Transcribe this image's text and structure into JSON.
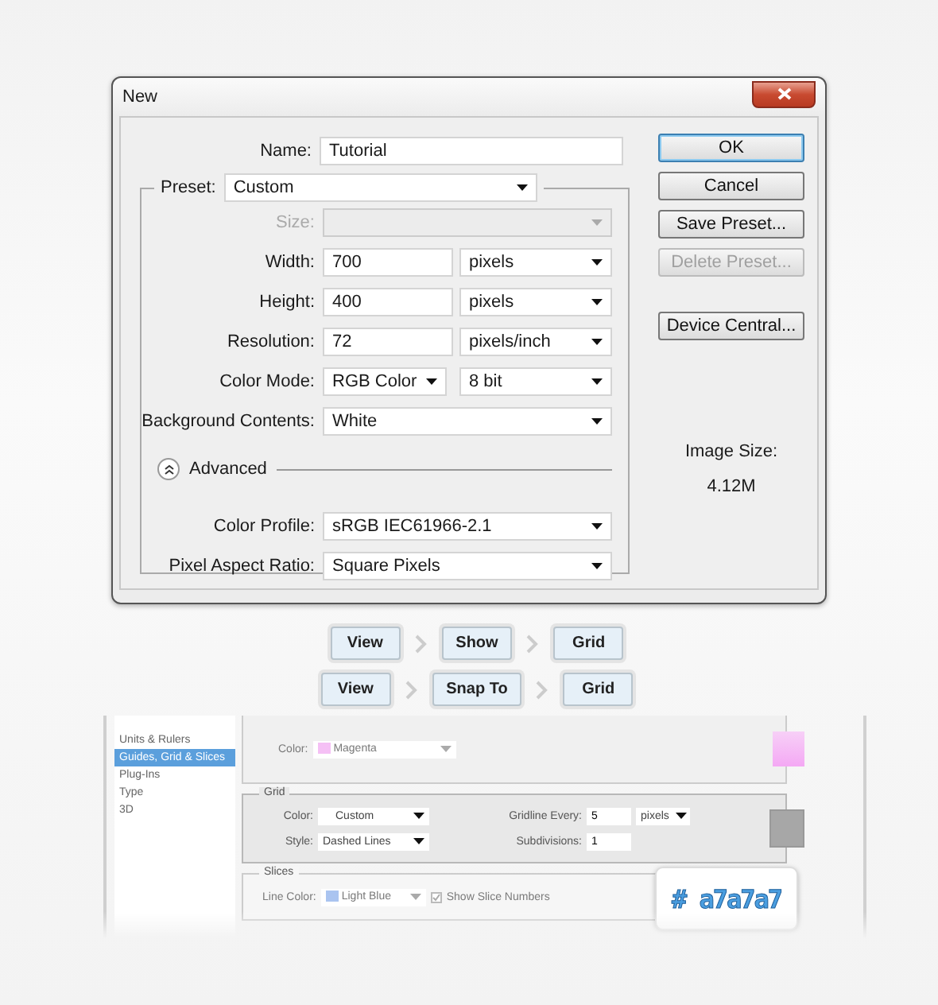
{
  "dialog": {
    "title": "New",
    "name_field": {
      "label": "Name:",
      "value": "Tutorial"
    },
    "preset": {
      "label": "Preset:",
      "value": "Custom"
    },
    "rows": [
      {
        "kind": "select",
        "label": "Size:",
        "disabled": true
      },
      {
        "kind": "pair",
        "label": "Width:",
        "value": "700",
        "unit": "pixels"
      },
      {
        "kind": "pair",
        "label": "Height:",
        "value": "400",
        "unit": "pixels"
      },
      {
        "kind": "pair",
        "label": "Resolution:",
        "value": "72",
        "unit": "pixels/inch"
      },
      {
        "kind": "double",
        "label": "Color Mode:",
        "value": "RGB Color",
        "unit": "8 bit"
      },
      {
        "kind": "select",
        "label": "Background Contents:",
        "value": "White",
        "disabled": false
      }
    ],
    "advanced": {
      "label": "Advanced",
      "expanded": true,
      "rows": [
        {
          "label": "Color Profile:",
          "value": "sRGB IEC61966-2.1"
        },
        {
          "label": "Pixel Aspect Ratio:",
          "value": "Square Pixels"
        }
      ]
    },
    "buttons": [
      {
        "label": "OK",
        "focused": true,
        "disabled": false
      },
      {
        "label": "Cancel",
        "focused": false,
        "disabled": false
      },
      {
        "label": "Save Preset...",
        "focused": false,
        "disabled": false
      },
      {
        "label": "Delete Preset...",
        "focused": false,
        "disabled": true
      },
      {
        "label": "Device Central...",
        "focused": false,
        "disabled": false
      }
    ],
    "image_size": {
      "label": "Image Size:",
      "value": "4.12M"
    }
  },
  "menu_paths": [
    {
      "steps": [
        "View",
        "Show",
        "Grid"
      ]
    },
    {
      "steps": [
        "View",
        "Snap To",
        "Grid"
      ]
    }
  ],
  "preferences": {
    "sidebar": [
      {
        "label": "Units & Rulers",
        "selected": false
      },
      {
        "label": "Guides, Grid & Slices",
        "selected": true
      },
      {
        "label": "Plug-Ins",
        "selected": false
      },
      {
        "label": "Type",
        "selected": false
      },
      {
        "label": "3D",
        "selected": false
      }
    ],
    "guides": {
      "color_label": "Color:",
      "color_value": "Magenta"
    },
    "grid": {
      "title": "Grid",
      "color_label": "Color:",
      "color_value": "Custom",
      "style_label": "Style:",
      "style_value": "Dashed Lines",
      "gridline_label": "Gridline Every:",
      "gridline_value": "5",
      "gridline_unit": "pixels",
      "subdivisions_label": "Subdivisions:",
      "subdivisions_value": "1"
    },
    "slices": {
      "title": "Slices",
      "line_color_label": "Line Color:",
      "line_color_value": "Light Blue",
      "show_numbers": {
        "label": "Show Slice Numbers",
        "checked": true
      }
    }
  },
  "badge": "# a7a7a7"
}
